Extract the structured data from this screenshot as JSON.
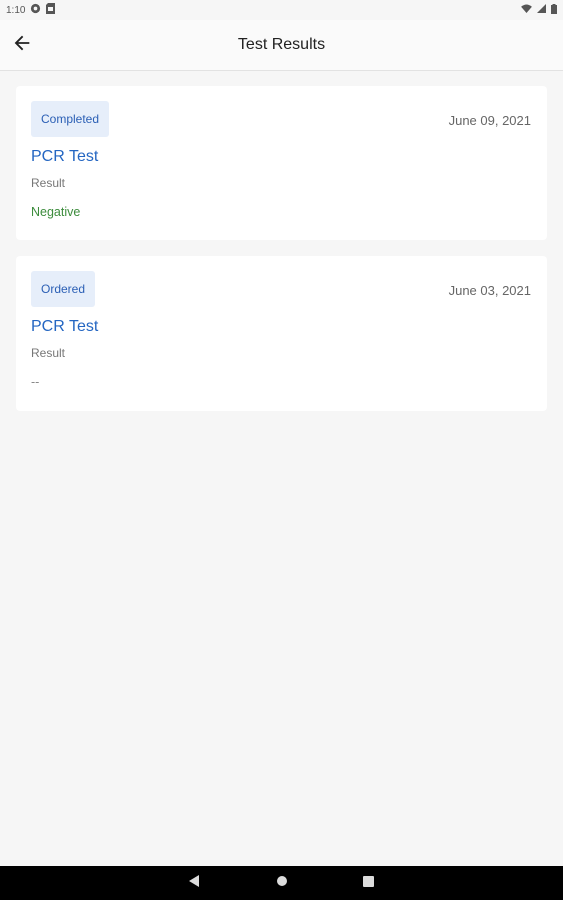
{
  "status_bar": {
    "time": "1:10",
    "left_icons": [
      "settings-status-icon",
      "sim-card-icon"
    ],
    "right_icons": [
      "wifi-icon",
      "signal-icon",
      "battery-icon"
    ]
  },
  "app_bar": {
    "title": "Test Results",
    "back_icon": "arrow-left-icon"
  },
  "results": [
    {
      "status": "Completed",
      "date": "June 09, 2021",
      "test_name": "PCR Test",
      "result_label": "Result",
      "result_value": "Negative",
      "result_color": "#3c8c3c"
    },
    {
      "status": "Ordered",
      "date": "June 03, 2021",
      "test_name": "PCR Test",
      "result_label": "Result",
      "result_value": "--",
      "result_color": "#888888"
    }
  ],
  "nav_bar": {
    "buttons": [
      "back-triangle-icon",
      "home-circle-icon",
      "recents-square-icon"
    ]
  },
  "colors": {
    "accent": "#2466c2",
    "badge_bg": "#e6eefa",
    "positive": "#3c8c3c"
  }
}
